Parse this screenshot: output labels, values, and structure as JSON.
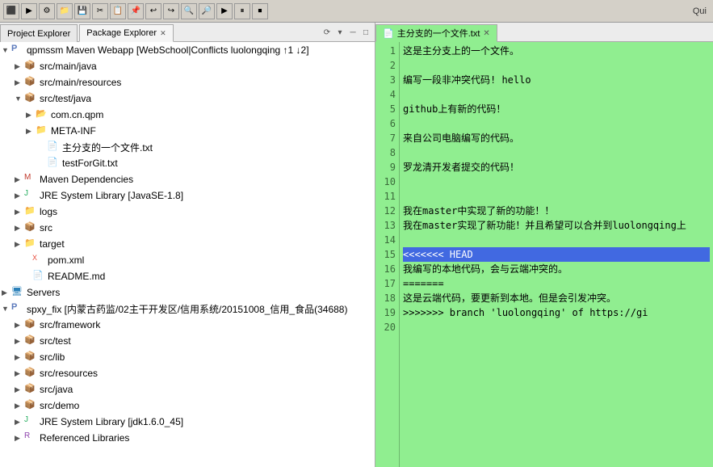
{
  "toolbar": {
    "quick_label": "Qui"
  },
  "left_panel": {
    "tabs": [
      {
        "id": "project-explorer",
        "label": "Project Explorer",
        "active": false
      },
      {
        "id": "package-explorer",
        "label": "Package Explorer",
        "active": true
      }
    ],
    "tree": [
      {
        "id": "root",
        "indent": 0,
        "arrow": "▼",
        "icon": "project",
        "label": "qpmssm Maven Webapp [WebSchool|Conflicts luolongqing ↑1 ↓2]",
        "level": 0
      },
      {
        "id": "src-main-java",
        "indent": 1,
        "arrow": "▶",
        "icon": "package",
        "label": "src/main/java",
        "level": 1
      },
      {
        "id": "src-main-resources",
        "indent": 1,
        "arrow": "▶",
        "icon": "package",
        "label": "src/main/resources",
        "level": 1
      },
      {
        "id": "src-test-java",
        "indent": 1,
        "arrow": "▼",
        "icon": "package",
        "label": "src/test/java",
        "level": 1
      },
      {
        "id": "com-cn-qpm",
        "indent": 2,
        "arrow": "▶",
        "icon": "package",
        "label": "com.cn.qpm",
        "level": 2
      },
      {
        "id": "META-INF",
        "indent": 2,
        "arrow": "▶",
        "icon": "folder",
        "label": "META-INF",
        "level": 2
      },
      {
        "id": "main-file",
        "indent": 2,
        "arrow": "",
        "icon": "file",
        "label": "主分支的一个文件.txt",
        "level": 2
      },
      {
        "id": "testForGit",
        "indent": 2,
        "arrow": "",
        "icon": "file",
        "label": "testForGit.txt",
        "level": 2
      },
      {
        "id": "maven-deps",
        "indent": 1,
        "arrow": "▶",
        "icon": "maven",
        "label": "Maven Dependencies",
        "level": 1
      },
      {
        "id": "jre-system",
        "indent": 1,
        "arrow": "▶",
        "icon": "lib",
        "label": "JRE System Library [JavaSE-1.8]",
        "level": 1
      },
      {
        "id": "logs",
        "indent": 1,
        "arrow": "▶",
        "icon": "folder",
        "label": "logs",
        "level": 1
      },
      {
        "id": "src",
        "indent": 1,
        "arrow": "▶",
        "icon": "package",
        "label": "src",
        "level": 1
      },
      {
        "id": "target",
        "indent": 1,
        "arrow": "▶",
        "icon": "folder",
        "label": "target",
        "level": 1
      },
      {
        "id": "pom-xml",
        "indent": 1,
        "arrow": "",
        "icon": "xml",
        "label": "pom.xml",
        "level": 1
      },
      {
        "id": "readme",
        "indent": 1,
        "arrow": "",
        "icon": "file",
        "label": "README.md",
        "level": 1
      },
      {
        "id": "servers",
        "indent": 0,
        "arrow": "▶",
        "icon": "server",
        "label": "Servers",
        "level": 0
      },
      {
        "id": "spxy-fix",
        "indent": 0,
        "arrow": "▼",
        "icon": "project",
        "label": "spxy_fix [内蒙古药监/02主干开发区/信用系统/20151008_信用_食品(34688)",
        "level": 0
      },
      {
        "id": "src-framework",
        "indent": 1,
        "arrow": "▶",
        "icon": "package",
        "label": "src/framework",
        "level": 1
      },
      {
        "id": "src-test",
        "indent": 1,
        "arrow": "▶",
        "icon": "package",
        "label": "src/test",
        "level": 1
      },
      {
        "id": "src-lib",
        "indent": 1,
        "arrow": "▶",
        "icon": "package",
        "label": "src/lib",
        "level": 1
      },
      {
        "id": "src-resources",
        "indent": 1,
        "arrow": "▶",
        "icon": "package",
        "label": "src/resources",
        "level": 1
      },
      {
        "id": "src-java",
        "indent": 1,
        "arrow": "▶",
        "icon": "package",
        "label": "src/java",
        "level": 1
      },
      {
        "id": "src-demo",
        "indent": 1,
        "arrow": "▶",
        "icon": "package",
        "label": "src/demo",
        "level": 1
      },
      {
        "id": "jre-system2",
        "indent": 1,
        "arrow": "▶",
        "icon": "lib",
        "label": "JRE System Library [jdk1.6.0_45]",
        "level": 1
      },
      {
        "id": "referenced-libraries",
        "indent": 1,
        "arrow": "▶",
        "icon": "ref",
        "label": "Referenced Libraries",
        "level": 1
      }
    ]
  },
  "editor": {
    "filename": "主分支的一个文件.txt",
    "lines": [
      {
        "num": 1,
        "text": "这是主分支上的一个文件。",
        "highlight": false
      },
      {
        "num": 2,
        "text": "",
        "highlight": false
      },
      {
        "num": 3,
        "text": "编写一段非冲突代码! hello",
        "highlight": false
      },
      {
        "num": 4,
        "text": "",
        "highlight": false
      },
      {
        "num": 5,
        "text": "github上有新的代码！",
        "highlight": false
      },
      {
        "num": 6,
        "text": "",
        "highlight": false
      },
      {
        "num": 7,
        "text": "来自公司电脑编写的代码。",
        "highlight": false
      },
      {
        "num": 8,
        "text": "",
        "highlight": false
      },
      {
        "num": 9,
        "text": "罗龙清开发者提交的代码！",
        "highlight": false
      },
      {
        "num": 10,
        "text": "",
        "highlight": false
      },
      {
        "num": 11,
        "text": "",
        "highlight": false
      },
      {
        "num": 12,
        "text": "我在master中实现了新的功能！！",
        "highlight": false
      },
      {
        "num": 13,
        "text": "我在master实现了新功能！并且希望可以合并到luolongqing上",
        "highlight": false
      },
      {
        "num": 14,
        "text": "",
        "highlight": false
      },
      {
        "num": 15,
        "text": "<<<<<<< HEAD",
        "highlight": true
      },
      {
        "num": 16,
        "text": "我编写的本地代码，会与云端冲突的。",
        "highlight": false
      },
      {
        "num": 17,
        "text": "=======",
        "highlight": false
      },
      {
        "num": 18,
        "text": "这是云端代码，要更新到本地。但是会引发冲突。",
        "highlight": false
      },
      {
        "num": 19,
        "text": ">>>>>>> branch 'luolongqing' of https://gi",
        "highlight": false
      },
      {
        "num": 20,
        "text": "",
        "highlight": false
      }
    ]
  }
}
